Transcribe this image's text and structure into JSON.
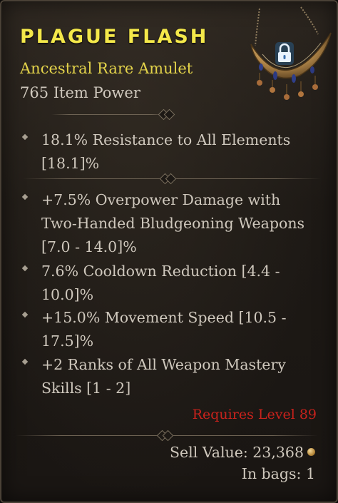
{
  "item": {
    "name": "PLAGUE FLASH",
    "type": "Ancestral Rare Amulet",
    "item_power": "765 Item Power"
  },
  "icons": {
    "item_image": "amulet-icon",
    "lock": "lock-icon",
    "currency": "gold-coin-icon"
  },
  "implicit_affixes": [
    {
      "text": "18.1% Resistance to All Elements [18.1]%"
    }
  ],
  "affixes": [
    {
      "text": "+7.5% Overpower Damage with Two-Handed Bludgeoning Weapons [7.0 - 14.0]%"
    },
    {
      "text": "7.6% Cooldown Reduction [4.4 - 10.0]%"
    },
    {
      "text": "+15.0% Movement Speed [10.5 - 17.5]%"
    },
    {
      "text": "+2 Ranks of All Weapon Mastery Skills [1 - 2]"
    }
  ],
  "requirement": "Requires Level 89",
  "footer": {
    "sell_value": "Sell Value: 23,368",
    "in_bags": "In bags: 1"
  },
  "colors": {
    "title": "#f4e84a",
    "rarity": "#e3d34a",
    "requirement": "#c8221c",
    "text": "#cfc8bd",
    "background": "#1d1915"
  }
}
